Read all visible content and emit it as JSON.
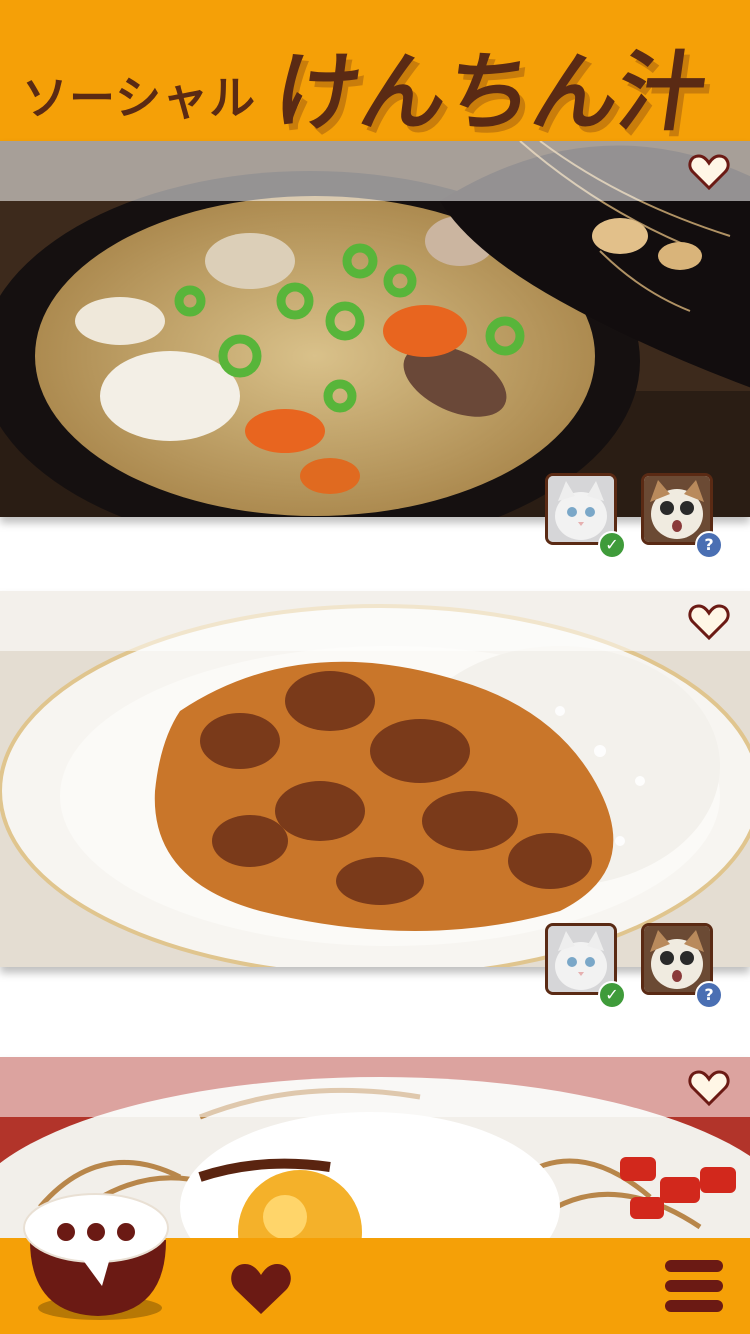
{
  "header": {
    "title_small": "ソーシャル",
    "title_large": "けんちん汁"
  },
  "feed": {
    "cards": [
      {
        "photo": "kenchin-jiru-bowl",
        "favorited": false,
        "friends": [
          {
            "avatar": "white-cat",
            "status": "confirmed"
          },
          {
            "avatar": "surprised-cat",
            "status": "unknown"
          }
        ]
      },
      {
        "photo": "beef-curry-rice",
        "favorited": false,
        "friends": [
          {
            "avatar": "white-cat",
            "status": "confirmed"
          },
          {
            "avatar": "surprised-cat",
            "status": "unknown"
          }
        ]
      },
      {
        "photo": "yakisoba-fried-egg",
        "favorited": false
      }
    ]
  },
  "badges": {
    "confirmed_glyph": "✓",
    "unknown_glyph": "?"
  },
  "bottom_bar": {
    "chat_icon": "rice-bowl-chat-icon",
    "favorites_icon": "heart-icon",
    "menu_icon": "hamburger-menu-icon"
  },
  "colors": {
    "brand_orange": "#f5a007",
    "dark_brown": "#5a2a14",
    "maroon": "#6b1a14",
    "confirmed_green": "#3f9b3a",
    "unknown_blue": "#4a6fb3"
  }
}
